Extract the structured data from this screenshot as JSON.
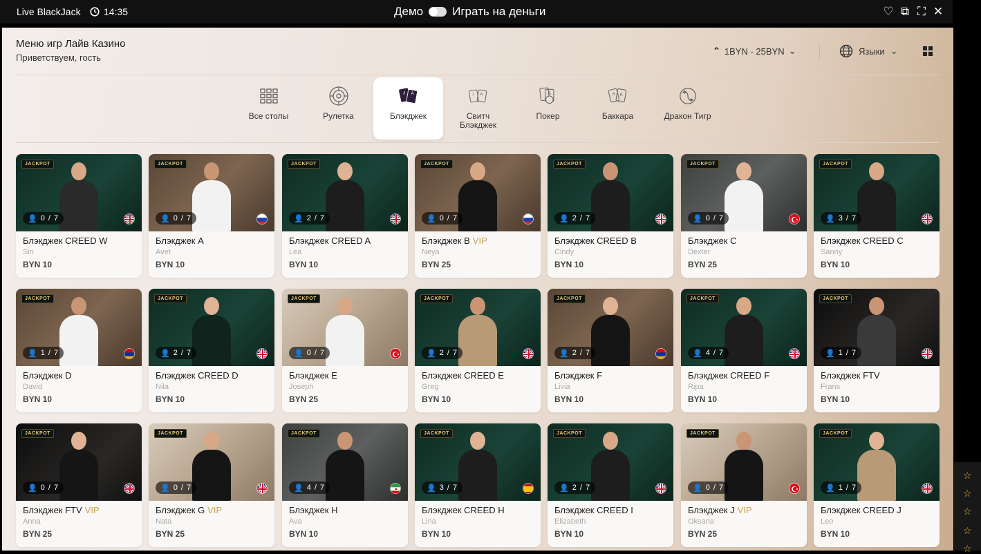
{
  "topbar": {
    "app_title": "Live BlackJack",
    "time": "14:35",
    "demo_label": "Демо",
    "real_label": "Играть на деньги"
  },
  "header": {
    "title": "Меню игр Лайв Казино",
    "subtitle": "Приветствуем, гость",
    "limits": "1BYN - 25BYN",
    "languages": "Языки"
  },
  "tabs": [
    {
      "label": "Все столы",
      "icon": "grid-icon",
      "active": false
    },
    {
      "label": "Рулетка",
      "icon": "roulette-icon",
      "active": false
    },
    {
      "label": "Блэкджек",
      "icon": "blackjack-cards-icon",
      "active": true
    },
    {
      "label": "Свитч Блэкджек",
      "icon": "switch-blackjack-icon",
      "active": false
    },
    {
      "label": "Покер",
      "icon": "poker-icon",
      "active": false
    },
    {
      "label": "Баккара",
      "icon": "baccarat-icon",
      "active": false
    },
    {
      "label": "Дракон Тигр",
      "icon": "dragon-tiger-icon",
      "active": false
    }
  ],
  "jackpot_label": "JACKPOT",
  "tables": [
    {
      "name": "Блэкджек CREED W",
      "vip": "",
      "dealer": "Siri",
      "seats": "0 / 7",
      "bet": "BYN 10",
      "flag": "uk",
      "bg": "green",
      "outfit": "#2a2a2a"
    },
    {
      "name": "Блэкджек A",
      "vip": "",
      "dealer": "Avet",
      "seats": "0 / 7",
      "bet": "BYN 10",
      "flag": "ru",
      "bg": "brown",
      "outfit": "#f2f2f2"
    },
    {
      "name": "Блэкджек CREED A",
      "vip": "",
      "dealer": "Lea",
      "seats": "2 / 7",
      "bet": "BYN 10",
      "flag": "uk",
      "bg": "green",
      "outfit": "#1d1d1d"
    },
    {
      "name": "Блэкджек B",
      "vip": "VIP",
      "dealer": "Neya",
      "seats": "0 / 7",
      "bet": "BYN 25",
      "flag": "ru",
      "bg": "brown",
      "outfit": "#151515"
    },
    {
      "name": "Блэкджек CREED B",
      "vip": "",
      "dealer": "Cindy",
      "seats": "2 / 7",
      "bet": "BYN 10",
      "flag": "uk",
      "bg": "green",
      "outfit": "#1d1d1d"
    },
    {
      "name": "Блэкджек C",
      "vip": "",
      "dealer": "Dexter",
      "seats": "0 / 7",
      "bet": "BYN 25",
      "flag": "tr",
      "bg": "grey",
      "outfit": "#f2f2f2"
    },
    {
      "name": "Блэкджек CREED C",
      "vip": "",
      "dealer": "Sanny",
      "seats": "3 / 7",
      "bet": "BYN 10",
      "flag": "uk",
      "bg": "green",
      "outfit": "#1d1d1d"
    },
    {
      "name": "Блэкджек D",
      "vip": "",
      "dealer": "David",
      "seats": "1 / 7",
      "bet": "BYN 10",
      "flag": "am",
      "bg": "brown",
      "outfit": "#f2f2f2"
    },
    {
      "name": "Блэкджек CREED D",
      "vip": "",
      "dealer": "Nila",
      "seats": "2 / 7",
      "bet": "BYN 10",
      "flag": "uk",
      "bg": "green",
      "outfit": "#10241d"
    },
    {
      "name": "Блэкджек E",
      "vip": "",
      "dealer": "Joseph",
      "seats": "0 / 7",
      "bet": "BYN 25",
      "flag": "tr",
      "bg": "cream",
      "outfit": "#f2f2f2"
    },
    {
      "name": "Блэкджек CREED E",
      "vip": "",
      "dealer": "Greg",
      "seats": "2 / 7",
      "bet": "BYN 10",
      "flag": "uk",
      "bg": "green",
      "outfit": "#b89a76"
    },
    {
      "name": "Блэкджек F",
      "vip": "",
      "dealer": "Livia",
      "seats": "2 / 7",
      "bet": "BYN 10",
      "flag": "am",
      "bg": "brown",
      "outfit": "#151515"
    },
    {
      "name": "Блэкджек CREED F",
      "vip": "",
      "dealer": "Ripa",
      "seats": "4 / 7",
      "bet": "BYN 10",
      "flag": "uk",
      "bg": "green",
      "outfit": "#1d1d1d"
    },
    {
      "name": "Блэкджек FTV",
      "vip": "",
      "dealer": "Frans",
      "seats": "1 / 7",
      "bet": "BYN 10",
      "flag": "uk",
      "bg": "black",
      "outfit": "#3a3a3a"
    },
    {
      "name": "Блэкджек FTV",
      "vip": "VIP",
      "dealer": "Anna",
      "seats": "0 / 7",
      "bet": "BYN 25",
      "flag": "uk",
      "bg": "black",
      "outfit": "#151515"
    },
    {
      "name": "Блэкджек G",
      "vip": "VIP",
      "dealer": "Nata",
      "seats": "0 / 7",
      "bet": "BYN 25",
      "flag": "uk",
      "bg": "cream",
      "outfit": "#151515"
    },
    {
      "name": "Блэкджек H",
      "vip": "",
      "dealer": "Ava",
      "seats": "4 / 7",
      "bet": "BYN 10",
      "flag": "ir",
      "bg": "grey",
      "outfit": "#151515"
    },
    {
      "name": "Блэкджек CREED H",
      "vip": "",
      "dealer": "Lina",
      "seats": "3 / 7",
      "bet": "BYN 10",
      "flag": "es",
      "bg": "green",
      "outfit": "#1d1d1d"
    },
    {
      "name": "Блэкджек CREED I",
      "vip": "",
      "dealer": "Elizabeth",
      "seats": "2 / 7",
      "bet": "BYN 10",
      "flag": "uk",
      "bg": "green",
      "outfit": "#1d1d1d"
    },
    {
      "name": "Блэкджек J",
      "vip": "VIP",
      "dealer": "Oksana",
      "seats": "0 / 7",
      "bet": "BYN 25",
      "flag": "tr",
      "bg": "cream",
      "outfit": "#151515"
    },
    {
      "name": "Блэкджек CREED J",
      "vip": "",
      "dealer": "Leo",
      "seats": "1 / 7",
      "bet": "BYN 10",
      "flag": "uk",
      "bg": "green",
      "outfit": "#b89a76"
    }
  ],
  "favorites": {
    "star": "☆"
  },
  "colors": {
    "vip": "#c9a157",
    "accent": "#2c1f3a"
  }
}
